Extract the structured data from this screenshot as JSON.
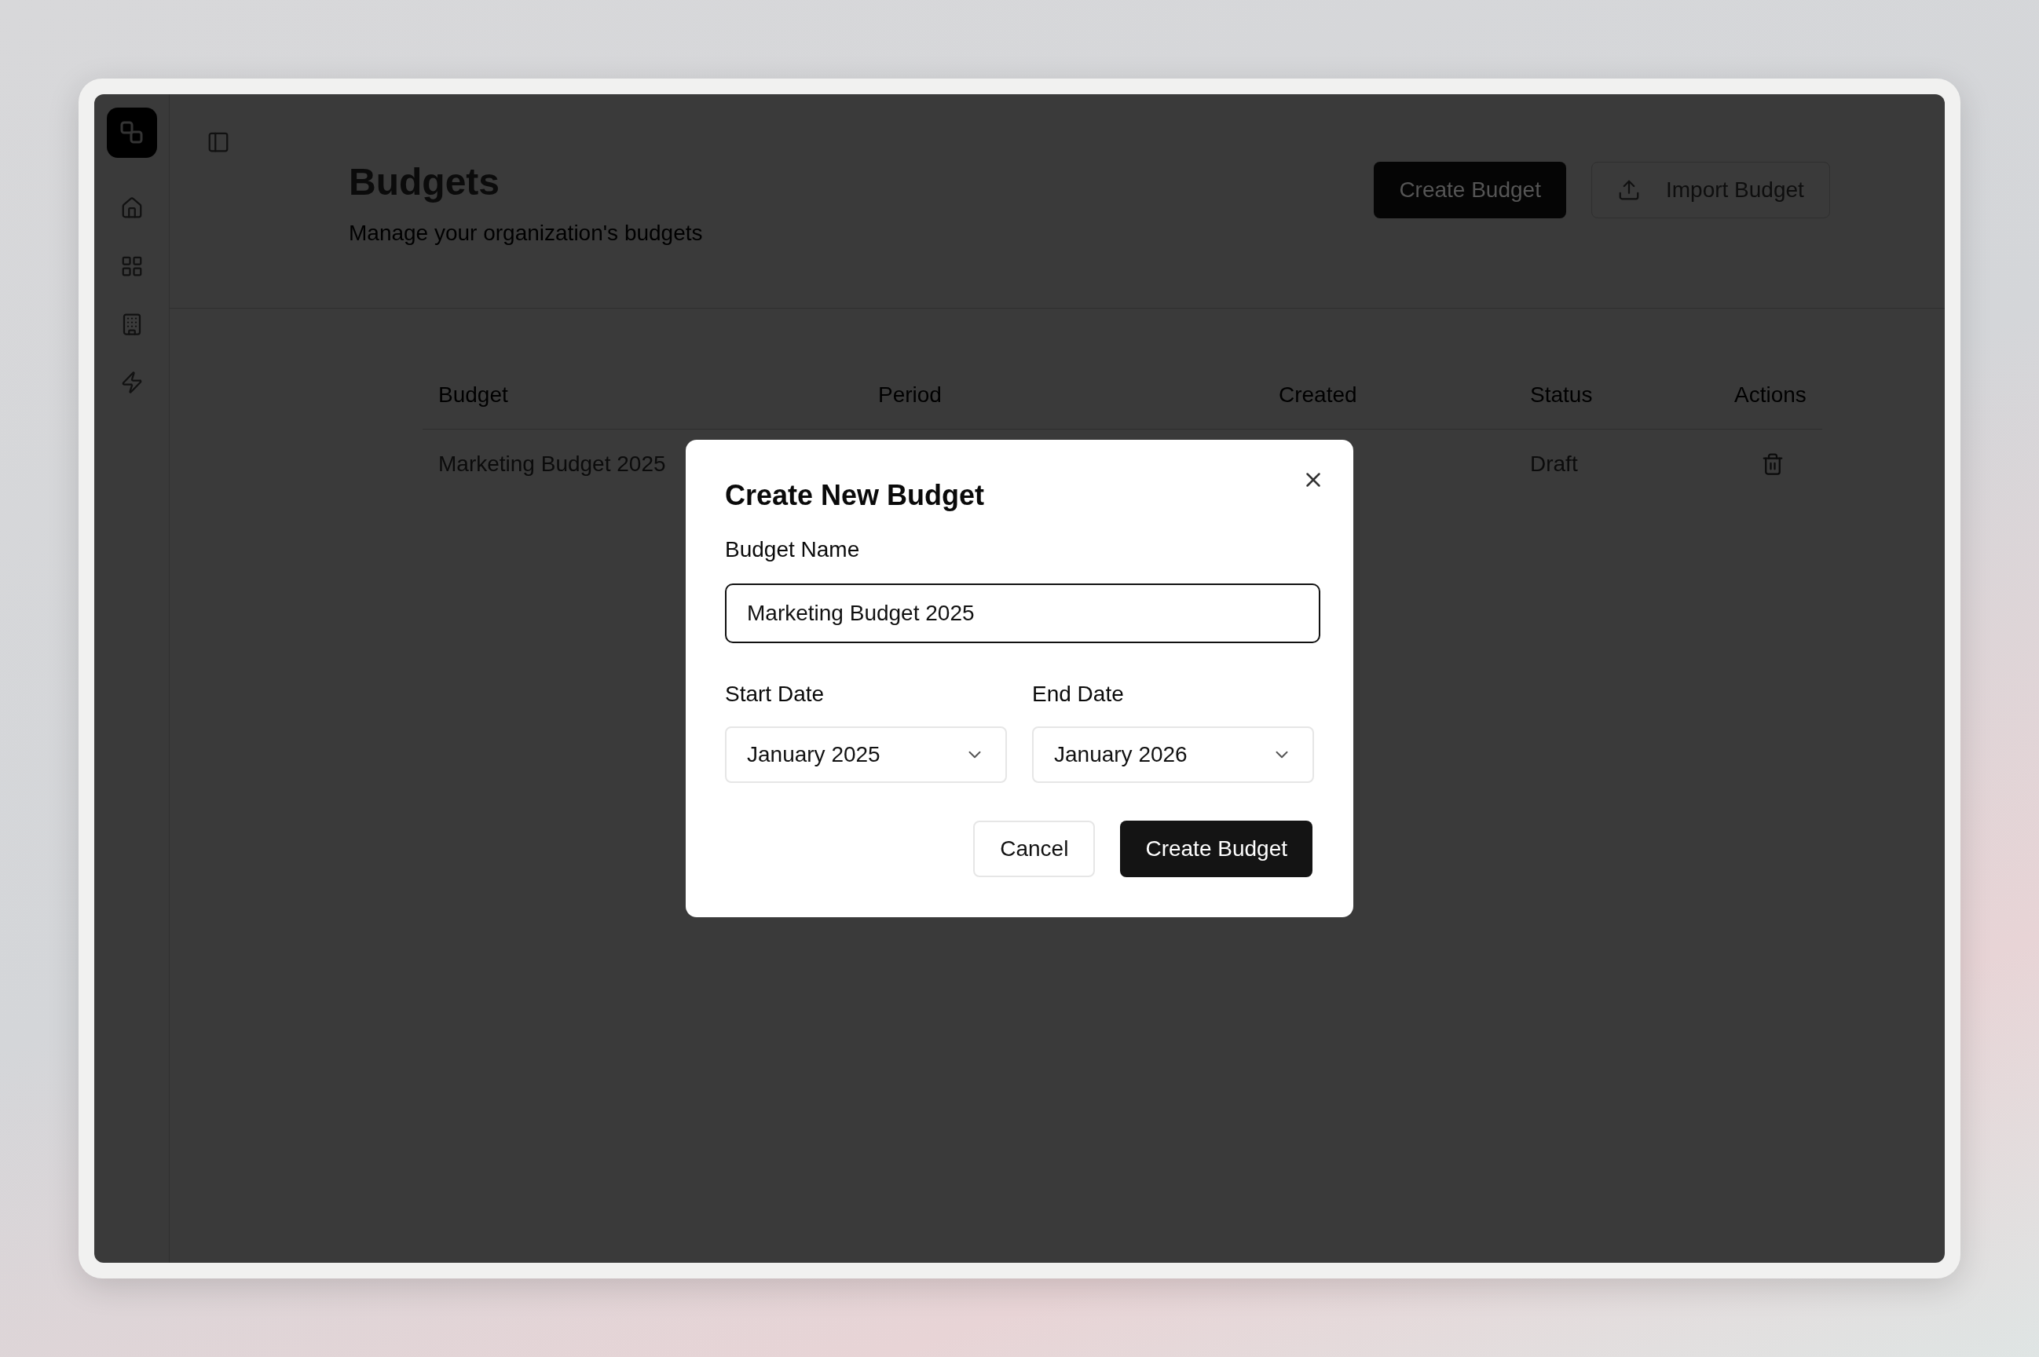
{
  "sidebar": {
    "items": [
      {
        "kind": "home",
        "selected": false
      },
      {
        "kind": "grid",
        "selected": false
      },
      {
        "kind": "building",
        "selected": false
      },
      {
        "kind": "bolt",
        "selected": false
      }
    ]
  },
  "header": {
    "title": "Budgets",
    "subtitle": "Manage your organization's budgets",
    "buttons": [
      {
        "kind": "primary",
        "label": "Create Budget"
      },
      {
        "kind": "upload",
        "label": "Import Budget"
      }
    ]
  },
  "table": {
    "columns": [
      "Budget",
      "Period",
      "Created",
      "Status",
      "Actions"
    ],
    "rows": [
      {
        "budget": "Marketing Budget 2025",
        "status": "Draft"
      }
    ]
  },
  "dialog": {
    "title": "Create New Budget",
    "name_label": "Budget Name",
    "name_value": "Marketing Budget 2025",
    "start_label": "Start Date",
    "start_value": "January 2025",
    "end_label": "End Date",
    "end_value": "January 2026",
    "buttons": [
      {
        "kind": "secondary",
        "label": "Cancel"
      },
      {
        "kind": "primary",
        "label": "Create Budget"
      }
    ]
  }
}
